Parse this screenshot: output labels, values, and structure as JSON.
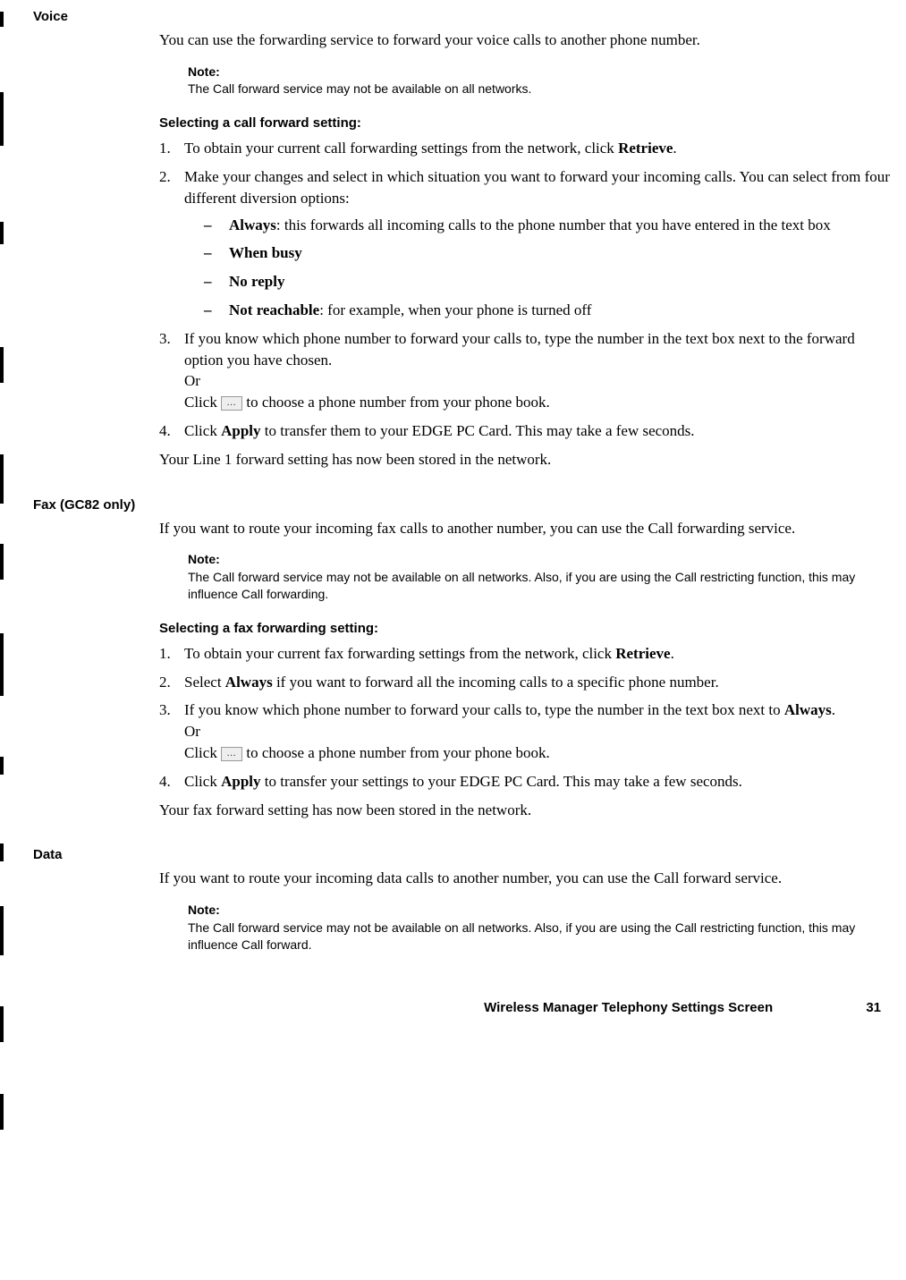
{
  "voice": {
    "label": "Voice",
    "intro": "You can use the forwarding service to forward your voice calls to another phone number.",
    "note_label": "Note:",
    "note_text": "The Call forward service may not be available on all networks.",
    "subheading": "Selecting a call forward setting:",
    "step1_pre": "To obtain your current call forwarding settings from the network, click ",
    "step1_bold": "Retrieve",
    "step1_post": ".",
    "step2": "Make your changes and select in which situation you want to forward your incoming calls. You can select from four different diversion options:",
    "bullet_always_bold": "Always",
    "bullet_always_post": ": this forwards all incoming calls to the phone number that you have entered in the text box",
    "bullet_busy": "When busy",
    "bullet_noreply": "No reply",
    "bullet_notreach_bold": "Not reachable",
    "bullet_notreach_post": ": for example, when your phone is turned off",
    "step3_line1": "If you know which phone number to forward your calls to, type the number in the text box next to the forward option you have chosen.",
    "step3_or": "Or",
    "step3_click": "Click ",
    "step3_click_post": " to choose a phone number from your phone book.",
    "step4_pre": "Click ",
    "step4_bold": "Apply",
    "step4_post": " to transfer them to your EDGE PC Card. This may take a few seconds.",
    "closing": "Your Line 1 forward setting has now been stored in the network."
  },
  "fax": {
    "label": "Fax (GC82 only)",
    "intro": "If you want to route your incoming fax calls to another number, you can use the Call forwarding service.",
    "note_label": "Note:",
    "note_text": "The Call forward service may not be available on all networks. Also, if you are using the Call restricting function, this may influence Call forwarding.",
    "subheading": "Selecting a fax forwarding setting:",
    "step1_pre": "To obtain your current fax forwarding settings from the network, click ",
    "step1_bold": "Retrieve",
    "step1_post": ".",
    "step2_pre": "Select ",
    "step2_bold": "Always",
    "step2_post": " if you want to forward all the incoming calls to a specific phone number.",
    "step3_line1_pre": "If you know which phone number to forward your calls to, type the number in the text box next to ",
    "step3_line1_bold": "Always",
    "step3_line1_post": ".",
    "step3_or": "Or",
    "step3_click": "Click ",
    "step3_click_post": " to choose a phone number from your phone book.",
    "step4_pre": "Click ",
    "step4_bold": "Apply",
    "step4_post": " to transfer your settings to your EDGE PC Card. This may take a few seconds.",
    "closing": "Your fax forward setting has now been stored in the network."
  },
  "data": {
    "label": "Data",
    "intro": "If you want to route your incoming data calls to another number, you can use the Call forward service.",
    "note_label": "Note:",
    "note_text": "The Call forward service may not be available on all networks. Also, if you are using the Call restricting function, this may influence Call forward."
  },
  "footer": {
    "title": "Wireless Manager Telephony Settings Screen",
    "page": "31"
  },
  "icon_dots": "..."
}
